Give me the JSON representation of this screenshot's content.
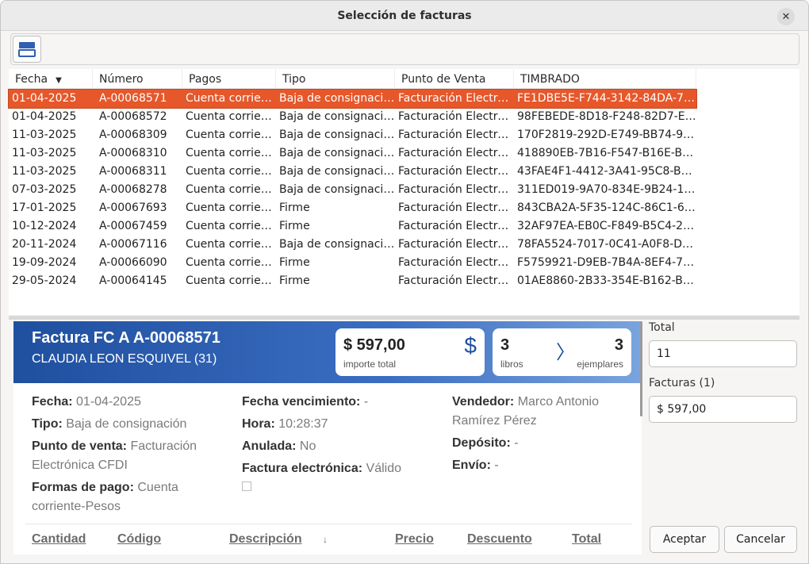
{
  "window": {
    "title": "Selección de facturas"
  },
  "grid": {
    "columns": [
      "Fecha",
      "Número",
      "Pagos",
      "Tipo",
      "Punto de Venta",
      "TIMBRADO"
    ],
    "rows": [
      {
        "fecha": "01-04-2025",
        "numero": "A-00068571",
        "pagos": "Cuenta corrien…",
        "tipo": "Baja de consignación",
        "pv": "Facturación Electró…",
        "timbrado": "FE1DBE5E-F744-3142-84DA-74…"
      },
      {
        "fecha": "01-04-2025",
        "numero": "A-00068572",
        "pagos": "Cuenta corrien…",
        "tipo": "Baja de consignación",
        "pv": "Facturación Electró…",
        "timbrado": "98FEBEDE-8D18-F248-82D7-EF…"
      },
      {
        "fecha": "11-03-2025",
        "numero": "A-00068309",
        "pagos": "Cuenta corrien…",
        "tipo": "Baja de consignación",
        "pv": "Facturación Electró…",
        "timbrado": "170F2819-292D-E749-BB74-938…"
      },
      {
        "fecha": "11-03-2025",
        "numero": "A-00068310",
        "pagos": "Cuenta corrien…",
        "tipo": "Baja de consignación",
        "pv": "Facturación Electró…",
        "timbrado": "418890EB-7B16-F547-B16E-B17…"
      },
      {
        "fecha": "11-03-2025",
        "numero": "A-00068311",
        "pagos": "Cuenta corrien…",
        "tipo": "Baja de consignación",
        "pv": "Facturación Electró…",
        "timbrado": "43FAE4F1-4412-3A41-95C8-B8C…"
      },
      {
        "fecha": "07-03-2025",
        "numero": "A-00068278",
        "pagos": "Cuenta corrien…",
        "tipo": "Baja de consignación",
        "pv": "Facturación Electró…",
        "timbrado": "311ED019-9A70-834E-9B24-166…"
      },
      {
        "fecha": "17-01-2025",
        "numero": "A-00067693",
        "pagos": "Cuenta corrien…",
        "tipo": "Firme",
        "pv": "Facturación Electró…",
        "timbrado": "843CBA2A-5F35-124C-86C1-69…"
      },
      {
        "fecha": "10-12-2024",
        "numero": "A-00067459",
        "pagos": "Cuenta corrien…",
        "tipo": "Firme",
        "pv": "Facturación Electró…",
        "timbrado": "32AF97EA-EB0C-F849-B5C4-2B…"
      },
      {
        "fecha": "20-11-2024",
        "numero": "A-00067116",
        "pagos": "Cuenta corrien…",
        "tipo": "Baja de consignación",
        "pv": "Facturación Electró…",
        "timbrado": "78FA5524-7017-0C41-A0F8-D53…"
      },
      {
        "fecha": "19-09-2024",
        "numero": "A-00066090",
        "pagos": "Cuenta corrien…",
        "tipo": "Firme",
        "pv": "Facturación Electró…",
        "timbrado": "F5759921-D9EB-7B4A-8EF4-72E…"
      },
      {
        "fecha": "29-05-2024",
        "numero": "A-00064145",
        "pagos": "Cuenta corrien…",
        "tipo": "Firme",
        "pv": "Facturación Electró…",
        "timbrado": "01AE8860-2B33-354E-B162-B8…"
      }
    ]
  },
  "detail": {
    "title": "Factura FC A A-00068571",
    "client": "CLAUDIA LEON ESQUIVEL (31)",
    "amount": "$ 597,00",
    "amount_label": "importe total",
    "books_count": "3",
    "books_label": "libros",
    "copies_count": "3",
    "copies_label": "ejemplares",
    "fields": {
      "fecha_label": "Fecha:",
      "fecha": "01-04-2025",
      "tipo_label": "Tipo:",
      "tipo": "Baja de consignación",
      "pv_label": "Punto de venta:",
      "pv": "Facturación Electrónica CFDI",
      "formas_label": "Formas de pago:",
      "formas": "Cuenta corriente-Pesos",
      "venc_label": "Fecha vencimiento:",
      "venc": "-",
      "hora_label": "Hora:",
      "hora": "10:28:37",
      "anulada_label": "Anulada:",
      "anulada": "No",
      "fe_label": "Factura electrónica:",
      "fe": "Válido",
      "vendedor_label": "Vendedor:",
      "vendedor": "Marco Antonio Ramírez Pérez",
      "deposito_label": "Depósito:",
      "deposito": "-",
      "envio_label": "Envío:",
      "envio": "-"
    },
    "lines_headers": {
      "cantidad": "Cantidad",
      "codigo": "Código",
      "descripcion": "Descripción",
      "precio": "Precio",
      "descuento": "Descuento",
      "total": "Total"
    }
  },
  "summary": {
    "total_label": "Total",
    "total_value": "11",
    "facturas_label": "Facturas (1)",
    "facturas_value": "$ 597,00"
  },
  "buttons": {
    "accept": "Aceptar",
    "cancel": "Cancelar"
  },
  "colors": {
    "selection": "#e6572a",
    "banner": "#1f4f9f"
  }
}
